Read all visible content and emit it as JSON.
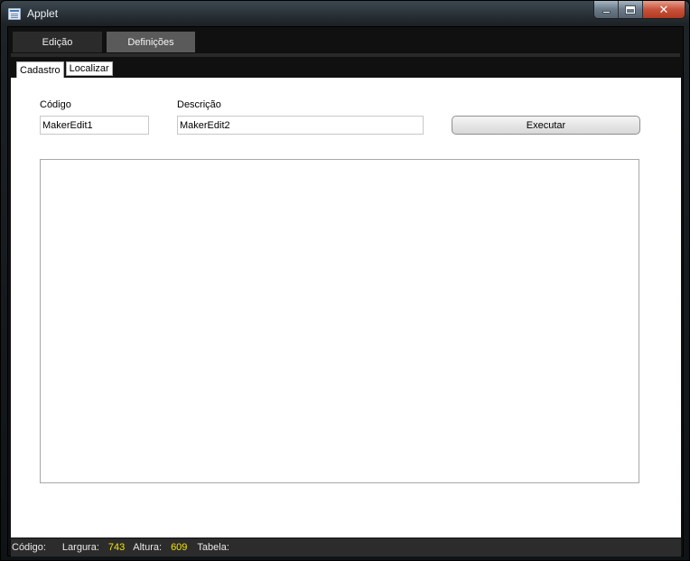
{
  "window": {
    "title": "Applet",
    "controls": {
      "minimize": "minimize-icon",
      "maximize": "maximize-icon",
      "close": "✕"
    }
  },
  "top_tabs": [
    {
      "label": "Edição",
      "active": true
    },
    {
      "label": "Definições",
      "active": false
    }
  ],
  "sub_tabs": [
    {
      "label": "Cadastro",
      "active": true
    },
    {
      "label": "Localizar",
      "active": false
    }
  ],
  "form": {
    "codigo_label": "Código",
    "codigo_value": "MakerEdit1",
    "descricao_label": "Descrição",
    "descricao_value": "MakerEdit2",
    "execute_label": "Executar"
  },
  "status": {
    "codigo_label": "Código:",
    "largura_label": "Largura:",
    "largura_value": "743",
    "altura_label": "Altura:",
    "altura_value": "609",
    "tabela_label": "Tabela:"
  },
  "colors": {
    "status_value": "#f5e400",
    "close_button": "#c8513a",
    "panel_background": "#ffffff"
  }
}
